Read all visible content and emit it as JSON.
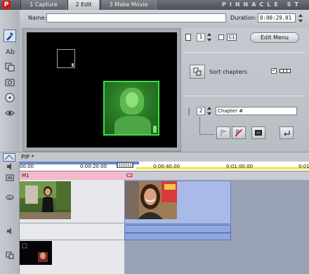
{
  "app": {
    "logo": "P",
    "brand": "PINNACLE ST"
  },
  "tabs": [
    {
      "label": "1 Capture"
    },
    {
      "label": "2 Edit"
    },
    {
      "label": "3 Make Movie"
    }
  ],
  "toolbar_icons": [
    "album-tab-icon",
    "titles-tab-icon",
    "transitions-tab-icon",
    "still-images-tab-icon",
    "disc-menus-tab-icon",
    "sound-effects-tab-icon"
  ],
  "name_row": {
    "name_label": "Name:",
    "name_value": "",
    "duration_label": "Duration:",
    "duration_value": "0:00:29.01"
  },
  "menu_panel": {
    "page_number": "1",
    "c1_tag": "C1",
    "edit_menu_label": "Edit Menu",
    "sort_chapters_label": "Sort chapters",
    "sort_chapters_checked": true,
    "chapter_number": "2",
    "chapter_title_value": "Chapter #"
  },
  "timeline": {
    "title": "PIP *",
    "ruler_ticks": [
      "00.00",
      "0:00:20.00",
      "0:00:40.00",
      "0:01:00.00",
      "0:01"
    ],
    "menu_markers": [
      {
        "label": "M1"
      },
      {
        "label": "C2"
      }
    ]
  }
}
